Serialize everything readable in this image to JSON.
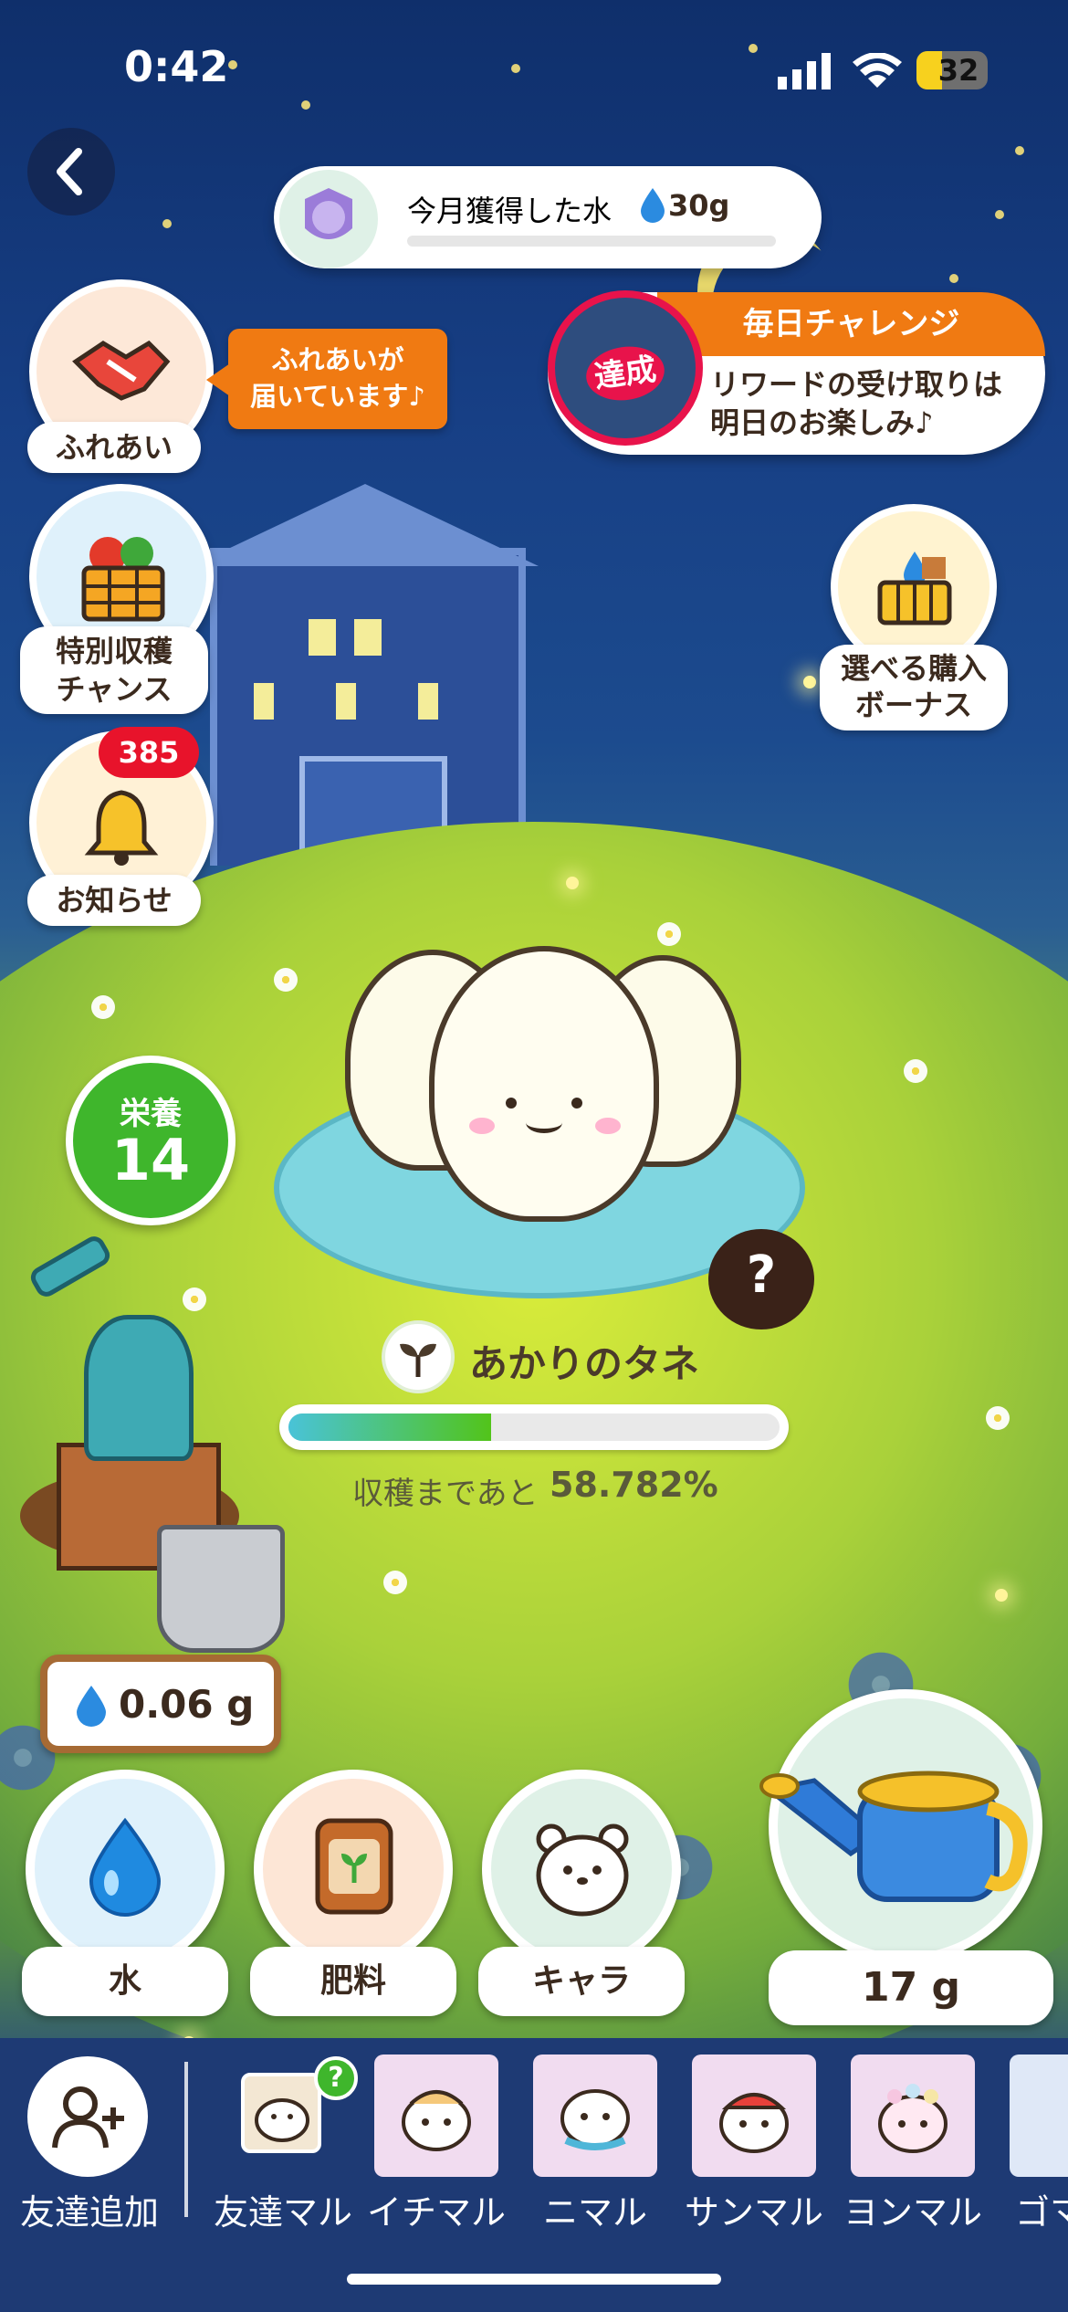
{
  "status_bar": {
    "time": "0:42",
    "battery": "32"
  },
  "water_monthly": {
    "label": "今月獲得した水",
    "amount": "30g",
    "progress": 0.0
  },
  "sidebar_left": [
    {
      "id": "fureai",
      "label": "ふれあい"
    },
    {
      "id": "special-harvest",
      "label": "特別収穫\nチャンス"
    },
    {
      "id": "notice",
      "label": "お知らせ",
      "badge": "385"
    }
  ],
  "fureai_tip": "ふれあいが\n届いています♪",
  "daily_challenge": {
    "title": "毎日チャレンジ",
    "stamp": "達成",
    "text": "リワードの受け取りは\n明日のお楽しみ♪"
  },
  "purchase_bonus": {
    "label": "選べる購入\nボーナス"
  },
  "nutrition": {
    "label": "栄養",
    "value": "14"
  },
  "plant": {
    "name": "あかりのタネ",
    "remaining_label": "収穫まであと",
    "remaining_value": "58.782%",
    "progress": 0.41222
  },
  "unknown_char": "?",
  "water_stock": "0.06 g",
  "actions": [
    {
      "id": "water",
      "label": "水"
    },
    {
      "id": "fertilizer",
      "label": "肥料"
    },
    {
      "id": "chara",
      "label": "キャラ"
    }
  ],
  "watering_can": {
    "amount": "17 g"
  },
  "friends_bar": {
    "add_label": "友達追加",
    "friend_label": "友達マル",
    "friend_badge": "?",
    "characters": [
      "イチマル",
      "ニマル",
      "サンマル",
      "ヨンマル",
      "ゴマル"
    ]
  },
  "colors": {
    "accent_orange": "#f07a12",
    "badge_red": "#e8132b",
    "progress_green": "#52c41a",
    "nutrition_green": "#3fb62c"
  }
}
